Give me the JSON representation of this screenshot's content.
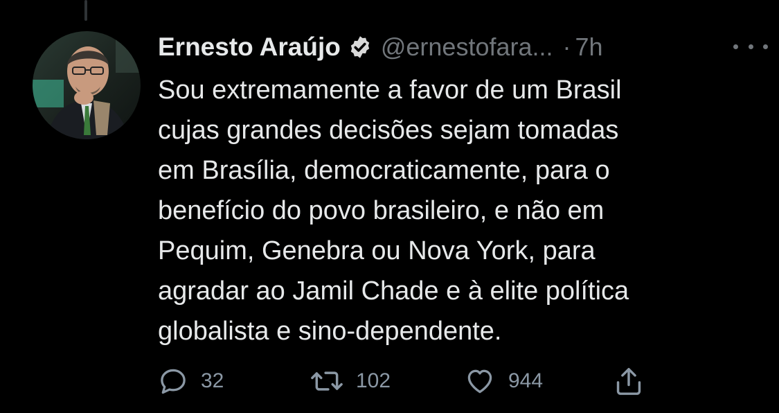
{
  "tweet": {
    "author": {
      "display_name": "Ernesto Araújo",
      "handle": "@ernestofara...",
      "verified": true,
      "avatar": "profile-photo"
    },
    "time_separator": "·",
    "time": "7h",
    "more_icon": "more-horizontal-icon",
    "text_lines": [
      "Sou extremamente a favor de um Brasil",
      "cujas grandes decisões sejam tomadas",
      "em Brasília, democraticamente, para o",
      "benefício do povo brasileiro, e não em",
      "Pequim, Genebra ou Nova York, para",
      "agradar ao Jamil Chade e à elite política",
      "globalista e sino-dependente."
    ],
    "actions": {
      "reply": {
        "icon": "reply-icon",
        "count": "32"
      },
      "retweet": {
        "icon": "retweet-icon",
        "count": "102"
      },
      "like": {
        "icon": "like-icon",
        "count": "944"
      },
      "share": {
        "icon": "share-icon"
      }
    }
  },
  "colors": {
    "background": "#000000",
    "text_primary": "#e7e9ea",
    "text_secondary": "#71767b",
    "action_icons": "#8b98a5"
  }
}
